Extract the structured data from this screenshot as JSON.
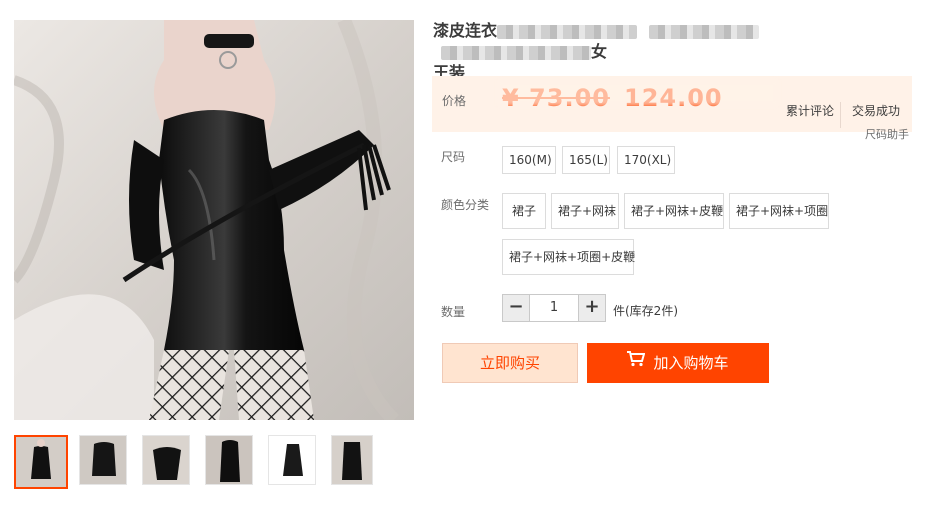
{
  "product": {
    "title_start": "漆皮连衣",
    "title_mid": "…",
    "title_end": "女",
    "title_line2": "王装"
  },
  "price": {
    "label": "价格",
    "original": "¥ 73.00",
    "current": "124.00"
  },
  "stats": {
    "reviews_label": "累计评论",
    "sales_label": "交易成功"
  },
  "size_helper": "尺码助手",
  "size": {
    "label": "尺码",
    "options": [
      "160(M)",
      "165(L)",
      "170(XL)"
    ]
  },
  "color": {
    "label": "颜色分类",
    "options": [
      "裙子",
      "裙子+网袜",
      "裙子+网袜+皮鞭",
      "裙子+网袜+项圈",
      "裙子+网袜+项圈+皮鞭"
    ]
  },
  "quantity": {
    "label": "数量",
    "minus": "−",
    "value": "1",
    "plus": "+",
    "stock_text": "件(库存2件)"
  },
  "actions": {
    "buy_now": "立即购买",
    "add_to_cart": "加入购物车"
  },
  "colors": {
    "accent": "#ff4400",
    "price_bg": "#fff2e8",
    "buy_now_bg": "#ffe4d0"
  },
  "gallery": {
    "thumbnail_count": 6,
    "active_index": 0
  }
}
